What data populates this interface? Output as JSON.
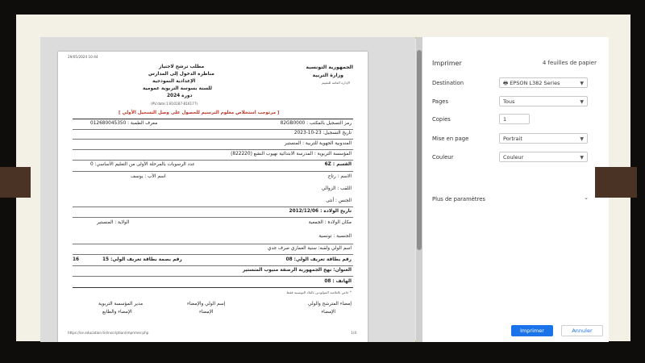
{
  "dialog": {
    "title": "Imprimer",
    "sheets": "4 feuilles de papier",
    "destination_label": "Destination",
    "destination_value": "EPSON L382 Series",
    "pages_label": "Pages",
    "pages_value": "Tous",
    "copies_label": "Copies",
    "copies_value": "1",
    "layout_label": "Mise en page",
    "layout_value": "Portrait",
    "color_label": "Couleur",
    "color_value": "Couleur",
    "more_label": "Plus de paramètres",
    "print_button": "Imprimer",
    "cancel_button": "Annuler"
  },
  "document": {
    "date_top": "29/05/2024 10:44",
    "header_right_1": "الجمهورية التونسية",
    "header_right_2": "وزارة التربية",
    "header_right_3": "الإدارة العامة للتقييم",
    "header_left_1": "مطلب ترشح لاجتياز",
    "header_left_2": "مناظرة الدخول إلى المدارس",
    "header_left_3": "الإعدادية النموذجية",
    "header_left_4": "للسنة بسوسة التربوية عمومية",
    "header_left_5": "دورة 2024",
    "header_left_6": "(PV:date:1:810187-816177)",
    "notice": "[ مرتوجب استخلاص معلوم الترسيم للحصول على وصل التسجيل الأولي ]",
    "reg_number": "رمز التسجيل بالمكتب : 82GB0000",
    "id_number": "معرف الطمبة : 012680045350",
    "reg_date": "تاريخ التسجيل: 23-10-2023",
    "region": "المندوبية الجهوية للتربية : المنستير",
    "school": "المؤسسة التربوية : المدرسة الابتدائية نهيوب النشع (822220)",
    "section": "القسم : 6Z",
    "years": "عدد الرسوبات بالمرحلة الأولى من التعليم الأساسي: 0",
    "first_name": "الاسم : رتاج",
    "father": "اسم الأب : يوسف",
    "surname": "اللقب : الزوالي",
    "sex": "الجنس : أنثى",
    "birth_date": "تاريخ الولادة : 2012/12/06",
    "birth_place": "مكان الولادة : الجمعية",
    "birth_state": "الولاية : المنستير",
    "nationality": "الجنسية : تونسية",
    "guardian": "اسم الولي ولقبه: سنية العماري صرف جدي",
    "id_card": "رقم بطاقة تعريف الولي: 08",
    "id_card_2": "رقم بصمة بطاقة تعريف الولي: 15",
    "id_card_3": "16",
    "address": "العنوان: نهج الجمهورية الرصفة منيوب المنستير",
    "phone": "الهاتف : 08",
    "footnote": "* خاص بالتلاميذ المولودين بالبلاد التونسية فقط",
    "sig_1a": "إمضاء المترشح والولي",
    "sig_1b": "الإمضاء",
    "sig_2a": "إسم الولي والإمضاء",
    "sig_2b": "الإمضاء",
    "sig_3a": "مدير المؤسسة التربوية",
    "sig_3b": "الإمضاء والطابع",
    "url": "https://ce.education.tn/inscription/imprimer.php",
    "page": "1/4"
  }
}
